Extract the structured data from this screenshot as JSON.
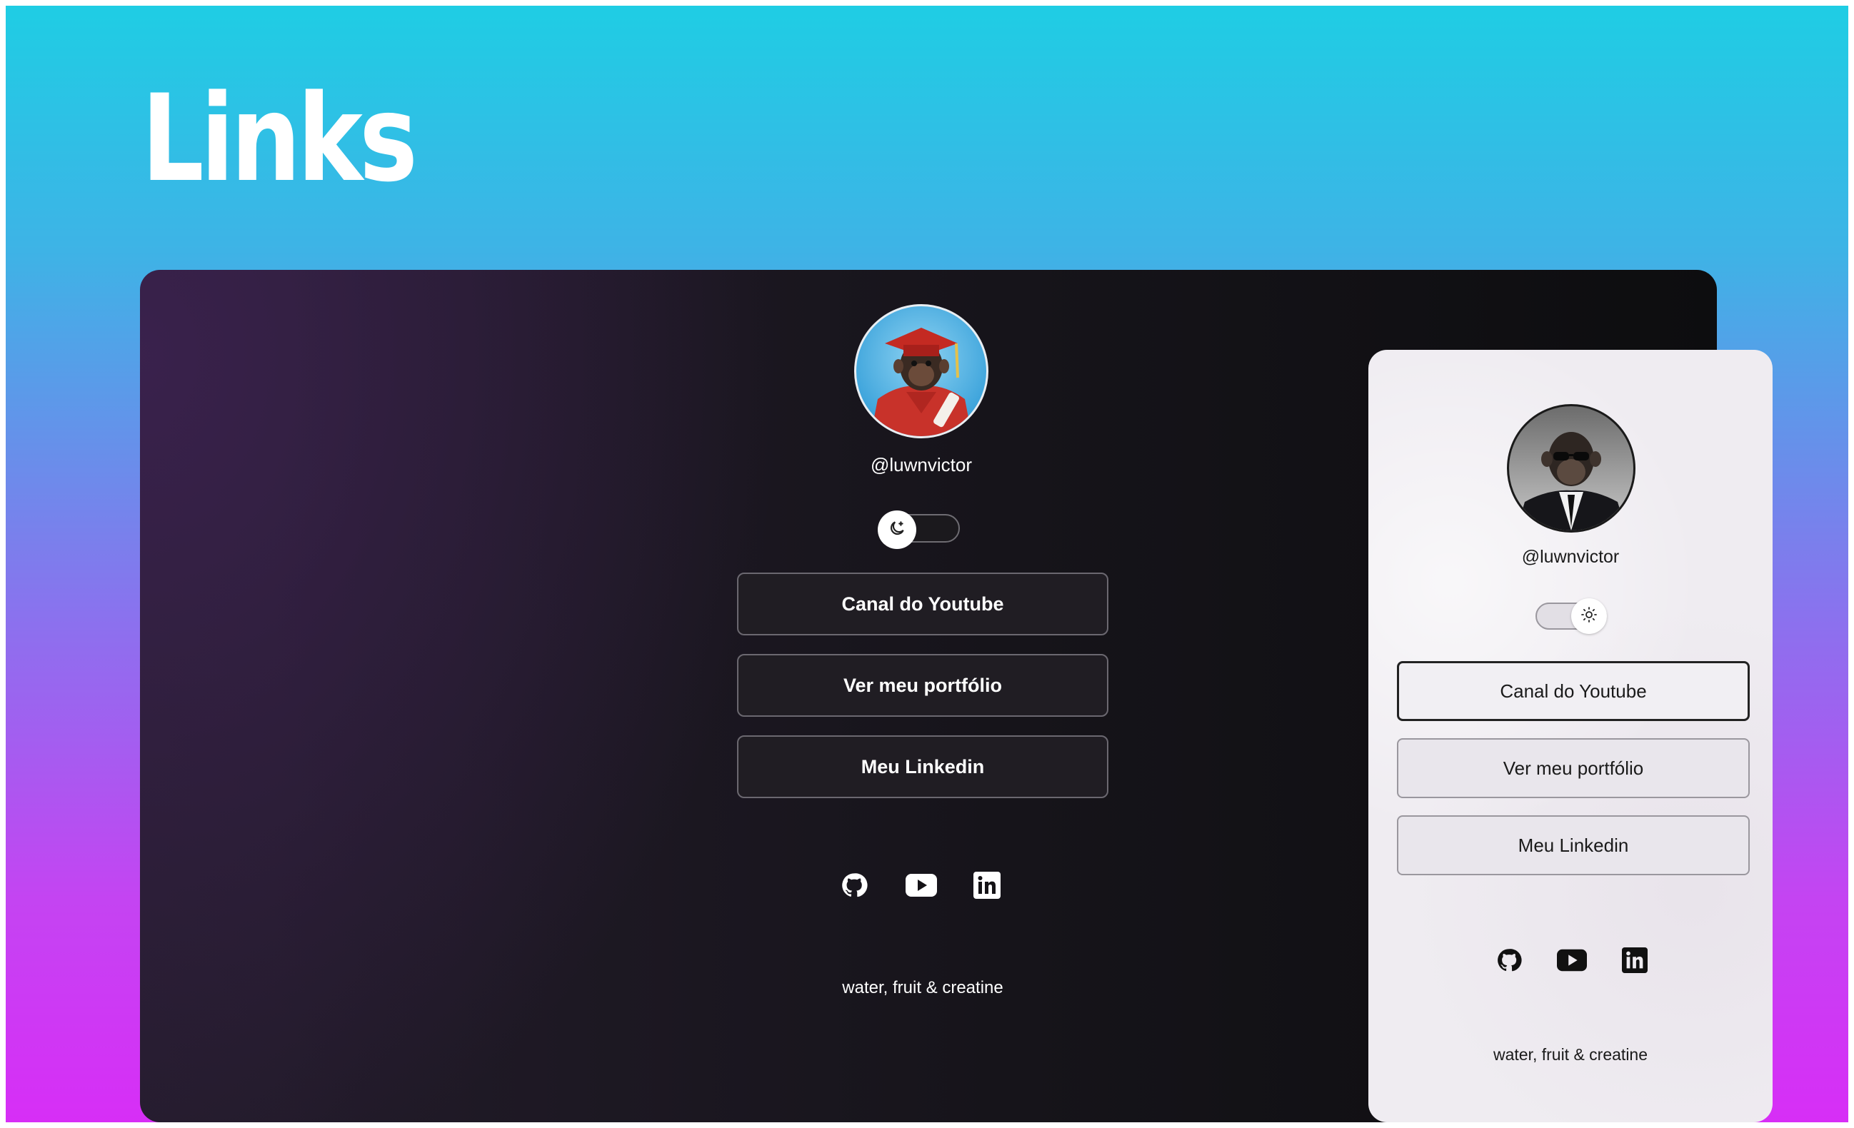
{
  "page": {
    "title": "Links"
  },
  "dark_theme": {
    "handle": "@luwnvictor",
    "toggle_icon": "moon-icon",
    "buttons": [
      {
        "label": "Canal do Youtube"
      },
      {
        "label": "Ver meu portfólio"
      },
      {
        "label": "Meu Linkedin"
      }
    ],
    "social_icons": [
      "github-icon",
      "youtube-icon",
      "linkedin-icon"
    ],
    "tagline": "water, fruit & creatine"
  },
  "light_theme": {
    "handle": "@luwnvictor",
    "toggle_icon": "sun-icon",
    "buttons": [
      {
        "label": "Canal do Youtube"
      },
      {
        "label": "Ver meu portfólio"
      },
      {
        "label": "Meu Linkedin"
      }
    ],
    "social_icons": [
      "github-icon",
      "youtube-icon",
      "linkedin-icon"
    ],
    "tagline": "water, fruit & creatine"
  },
  "colors": {
    "gradient_top": "#1fcde4",
    "gradient_bottom": "#d72ef6",
    "dark_card": "#16141a",
    "light_card": "#efecf1"
  }
}
